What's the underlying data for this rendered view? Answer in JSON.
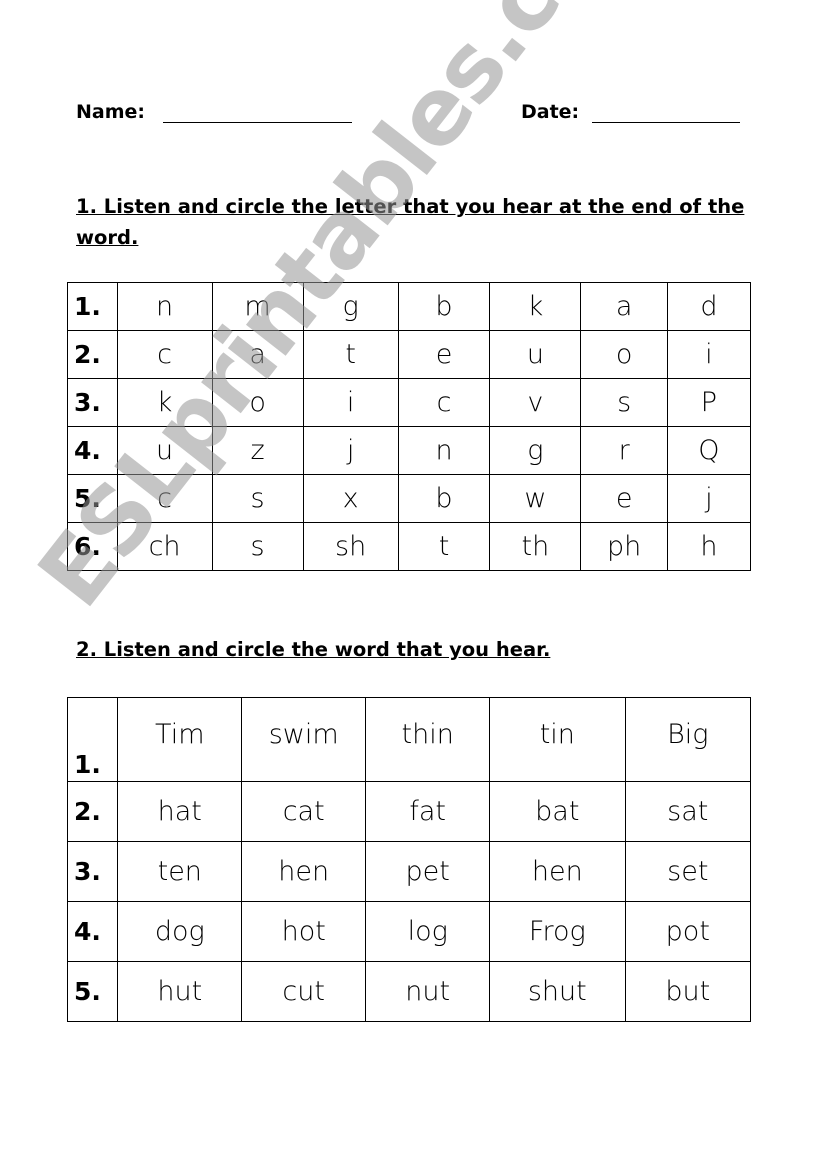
{
  "header": {
    "name_label": "Name:",
    "date_label": "Date:"
  },
  "section1": {
    "instruction": "1. Listen and circle the letter that you hear at the end of the word.",
    "rows": [
      {
        "num": "1.",
        "cells": [
          "n",
          "m",
          "g",
          "b",
          "k",
          "a",
          "d"
        ]
      },
      {
        "num": "2.",
        "cells": [
          "c",
          "a",
          "t",
          "e",
          "u",
          "o",
          "i"
        ]
      },
      {
        "num": "3.",
        "cells": [
          "k",
          "o",
          "i",
          "c",
          "v",
          "s",
          "P"
        ]
      },
      {
        "num": "4.",
        "cells": [
          "u",
          "z",
          "j",
          "n",
          "g",
          "r",
          "Q"
        ]
      },
      {
        "num": "5.",
        "cells": [
          "c",
          "s",
          "x",
          "b",
          "w",
          "e",
          "j"
        ]
      },
      {
        "num": "6.",
        "cells": [
          "ch",
          "s",
          "sh",
          "t",
          "th",
          "ph",
          "h"
        ]
      }
    ]
  },
  "section2": {
    "instruction": "2. Listen and circle the word that you hear.",
    "rows": [
      {
        "num": "1.",
        "cells": [
          "Tim",
          "swim",
          "thin",
          "tin",
          "Big"
        ]
      },
      {
        "num": "2.",
        "cells": [
          "hat",
          "cat",
          "fat",
          "bat",
          "sat"
        ]
      },
      {
        "num": "3.",
        "cells": [
          "ten",
          "hen",
          "pet",
          "hen",
          "set"
        ]
      },
      {
        "num": "4.",
        "cells": [
          "dog",
          "hot",
          "log",
          "Frog",
          "pot"
        ]
      },
      {
        "num": "5.",
        "cells": [
          "hut",
          "cut",
          "nut",
          "shut",
          "but"
        ]
      }
    ]
  },
  "watermark": "ESLprintables.com"
}
